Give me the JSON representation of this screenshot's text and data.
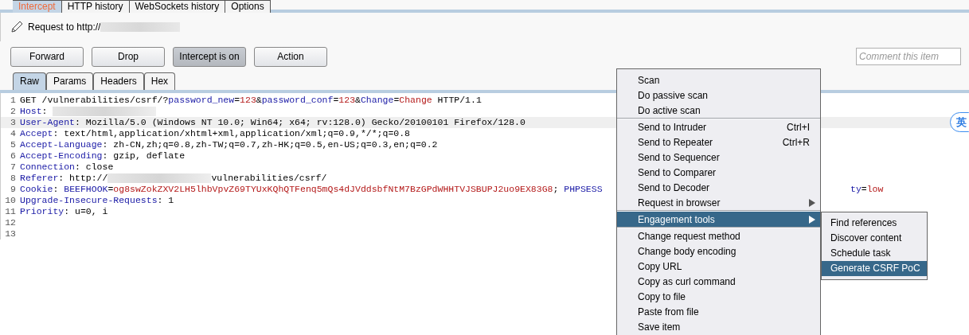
{
  "tabs": [
    {
      "label": "Intercept",
      "selected": true
    },
    {
      "label": "HTTP history",
      "selected": false
    },
    {
      "label": "WebSockets history",
      "selected": false
    },
    {
      "label": "Options",
      "selected": false
    }
  ],
  "request_label": "Request to http://",
  "buttons": [
    {
      "label": "Forward",
      "selected": false
    },
    {
      "label": "Drop",
      "selected": false
    },
    {
      "label": "Intercept is on",
      "selected": true
    },
    {
      "label": "Action",
      "selected": false
    }
  ],
  "comment": {
    "placeholder": "Comment this item"
  },
  "view_tabs": [
    {
      "label": "Raw",
      "selected": true
    },
    {
      "label": "Params",
      "selected": false
    },
    {
      "label": "Headers",
      "selected": false
    },
    {
      "label": "Hex",
      "selected": false
    }
  ],
  "lines": [
    {
      "number": "1",
      "highlighted": false,
      "segments": [
        {
          "kind": "plain",
          "text": "GET /vulnerabilities/csrf/?"
        },
        {
          "kind": "name",
          "text": "password_new"
        },
        {
          "kind": "plain",
          "text": "="
        },
        {
          "kind": "value",
          "text": "123"
        },
        {
          "kind": "plain",
          "text": "&"
        },
        {
          "kind": "name",
          "text": "password_conf"
        },
        {
          "kind": "plain",
          "text": "="
        },
        {
          "kind": "value",
          "text": "123"
        },
        {
          "kind": "plain",
          "text": "&"
        },
        {
          "kind": "name",
          "text": "Change"
        },
        {
          "kind": "plain",
          "text": "="
        },
        {
          "kind": "value",
          "text": "Change"
        },
        {
          "kind": "plain",
          "text": " HTTP/1.1"
        }
      ]
    },
    {
      "number": "2",
      "highlighted": false,
      "segments": [
        {
          "kind": "name",
          "text": "Host"
        },
        {
          "kind": "plain",
          "text": ": "
        },
        {
          "kind": "redacted"
        }
      ]
    },
    {
      "number": "3",
      "highlighted": true,
      "segments": [
        {
          "kind": "name",
          "text": "User-Agent"
        },
        {
          "kind": "plain",
          "text": ": Mozilla/5.0 (Windows NT 10.0; Win64; x64; rv:128.0) Gecko/20100101 Firefox/128.0"
        }
      ]
    },
    {
      "number": "4",
      "highlighted": false,
      "segments": [
        {
          "kind": "name",
          "text": "Accept"
        },
        {
          "kind": "plain",
          "text": ": text/html,application/xhtml+xml,application/xml;q=0.9,*/*;q=0.8"
        }
      ]
    },
    {
      "number": "5",
      "highlighted": false,
      "segments": [
        {
          "kind": "name",
          "text": "Accept-Language"
        },
        {
          "kind": "plain",
          "text": ": zh-CN,zh;q=0.8,zh-TW;q=0.7,zh-HK;q=0.5,en-US;q=0.3,en;q=0.2"
        }
      ]
    },
    {
      "number": "6",
      "highlighted": false,
      "segments": [
        {
          "kind": "name",
          "text": "Accept-Encoding"
        },
        {
          "kind": "plain",
          "text": ": gzip, deflate"
        }
      ]
    },
    {
      "number": "7",
      "highlighted": false,
      "segments": [
        {
          "kind": "name",
          "text": "Connection"
        },
        {
          "kind": "plain",
          "text": ": close"
        }
      ]
    },
    {
      "number": "8",
      "highlighted": false,
      "segments": [
        {
          "kind": "name",
          "text": "Referer"
        },
        {
          "kind": "plain",
          "text": ": http://"
        },
        {
          "kind": "redacted"
        },
        {
          "kind": "plain",
          "text": "vulnerabilities/csrf/"
        }
      ]
    },
    {
      "number": "9",
      "highlighted": false,
      "segments": [
        {
          "kind": "name",
          "text": "Cookie"
        },
        {
          "kind": "plain",
          "text": ": "
        },
        {
          "kind": "name",
          "text": "BEEFHOOK"
        },
        {
          "kind": "plain",
          "text": "="
        },
        {
          "kind": "value",
          "text": "og8swZokZXV2LH5lhbVpvZ69TYUxKQhQTFenq5mQs4dJVddsbfNtM7BzGPdWHHTVJSBUPJ2uo9EX83G8"
        },
        {
          "kind": "plain",
          "text": "; "
        },
        {
          "kind": "name",
          "text": "PHPSESS"
        }
      ],
      "tail": [
        {
          "kind": "name",
          "text": "ty"
        },
        {
          "kind": "plain",
          "text": "="
        },
        {
          "kind": "value",
          "text": "low"
        }
      ]
    },
    {
      "number": "10",
      "highlighted": false,
      "segments": [
        {
          "kind": "name",
          "text": "Upgrade-Insecure-Requests"
        },
        {
          "kind": "plain",
          "text": ": 1"
        }
      ]
    },
    {
      "number": "11",
      "highlighted": false,
      "segments": [
        {
          "kind": "name",
          "text": "Priority"
        },
        {
          "kind": "plain",
          "text": ": u=0, i"
        }
      ]
    },
    {
      "number": "12",
      "highlighted": false
    },
    {
      "number": "13",
      "highlighted": false
    }
  ],
  "ime_indicator": "英",
  "context_menu": [
    {
      "label": "Scan",
      "selected": false,
      "separator_after": false
    },
    {
      "label": "Do passive scan",
      "selected": false,
      "separator_after": false
    },
    {
      "label": "Do active scan",
      "selected": false,
      "separator_after": true
    },
    {
      "label": "Send to Intruder",
      "shortcut": "Ctrl+I",
      "selected": false,
      "separator_after": false
    },
    {
      "label": "Send to Repeater",
      "shortcut": "Ctrl+R",
      "selected": false,
      "separator_after": false
    },
    {
      "label": "Send to Sequencer",
      "selected": false,
      "separator_after": false
    },
    {
      "label": "Send to Comparer",
      "selected": false,
      "separator_after": false
    },
    {
      "label": "Send to Decoder",
      "selected": false,
      "separator_after": false
    },
    {
      "label": "Request in browser",
      "submenu": true,
      "selected": false,
      "separator_after": true
    },
    {
      "label": "Engagement tools",
      "submenu": true,
      "selected": true,
      "separator_after": true
    },
    {
      "label": "Change request method",
      "selected": false,
      "separator_after": false
    },
    {
      "label": "Change body encoding",
      "selected": false,
      "separator_after": false
    },
    {
      "label": "Copy URL",
      "selected": false,
      "separator_after": false
    },
    {
      "label": "Copy as curl command",
      "selected": false,
      "separator_after": false
    },
    {
      "label": "Copy to file",
      "selected": false,
      "separator_after": false
    },
    {
      "label": "Paste from file",
      "selected": false,
      "separator_after": false
    },
    {
      "label": "Save item",
      "selected": false,
      "separator_after": false
    }
  ],
  "submenu": [
    {
      "label": "Find references",
      "selected": false
    },
    {
      "label": "Discover content",
      "selected": false
    },
    {
      "label": "Schedule task",
      "selected": false
    },
    {
      "label": "Generate CSRF PoC",
      "selected": true
    }
  ]
}
